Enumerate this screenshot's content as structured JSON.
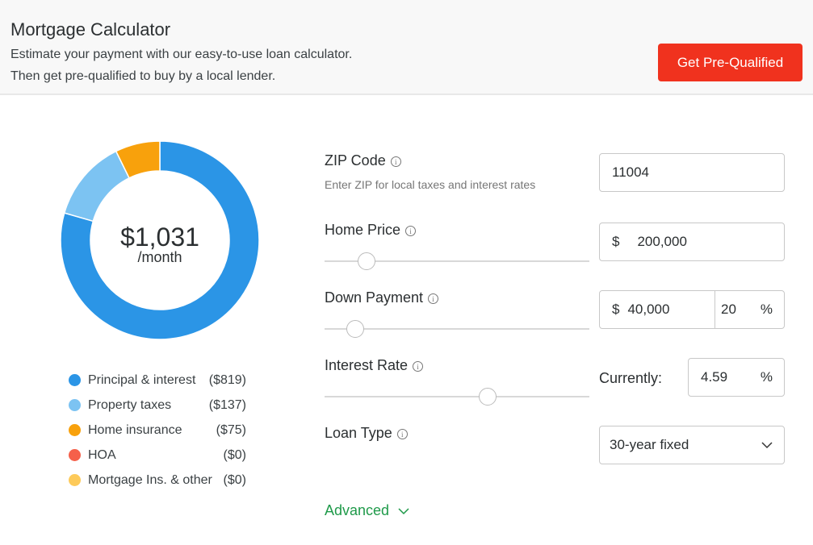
{
  "header": {
    "title": "Mortgage Calculator",
    "line1": "Estimate your payment with our easy-to-use loan calculator.",
    "line2": "Then get pre-qualified to buy by a local lender.",
    "cta": "Get Pre-Qualified"
  },
  "summary": {
    "total": "$1,031",
    "period": "/month"
  },
  "chart_data": {
    "type": "pie",
    "variant": "donut",
    "series": [
      {
        "name": "Principal & interest",
        "value": 819,
        "label": "($819)",
        "color": "#2b95e6"
      },
      {
        "name": "Property taxes",
        "value": 137,
        "label": "($137)",
        "color": "#7cc3f2"
      },
      {
        "name": "Home insurance",
        "value": 75,
        "label": "($75)",
        "color": "#f8a10c"
      },
      {
        "name": "HOA",
        "value": 0,
        "label": "($0)",
        "color": "#f5604a"
      },
      {
        "name": "Mortgage Ins. & other",
        "value": 0,
        "label": "($0)",
        "color": "#fdca5a"
      }
    ]
  },
  "form": {
    "zip": {
      "label": "ZIP Code",
      "hint": "Enter ZIP for local taxes and interest rates",
      "value": "11004"
    },
    "home_price": {
      "label": "Home Price",
      "currency": "$",
      "value": "200,000",
      "slider": 0.16
    },
    "down_payment": {
      "label": "Down Payment",
      "currency": "$",
      "value": "40,000",
      "percent": "20",
      "percent_sign": "%",
      "slider": 0.115
    },
    "interest_rate": {
      "label": "Interest Rate",
      "currently": "Currently:",
      "value": "4.59",
      "percent_sign": "%",
      "slider": 0.615
    },
    "loan_type": {
      "label": "Loan Type",
      "value": "30-year fixed"
    },
    "advanced": "Advanced"
  }
}
